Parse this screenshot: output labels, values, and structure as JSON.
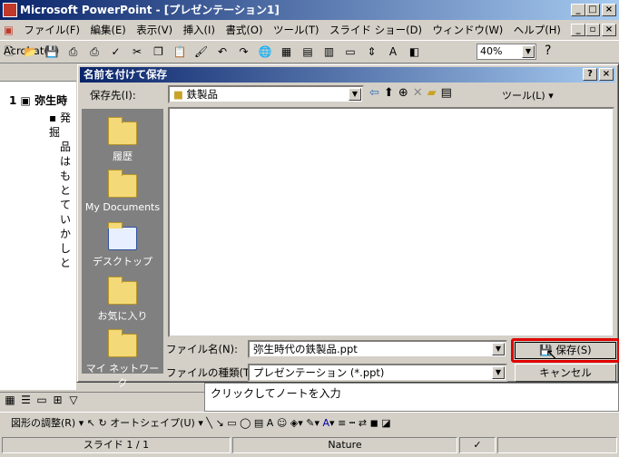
{
  "window": {
    "title": "Microsoft PowerPoint - [プレゼンテーション1]"
  },
  "menu": [
    "ファイル(F)",
    "編集(E)",
    "表示(V)",
    "挿入(I)",
    "書式(O)",
    "ツール(T)",
    "スライド ショー(D)",
    "ウィンドウ(W)",
    "ヘルプ(H)",
    "Acrobat(B)"
  ],
  "toolbar": {
    "zoom": "40%"
  },
  "outline": {
    "slide_number": "1",
    "slide_title": "弥生時",
    "lines": [
      "発掘",
      "品は",
      "もと",
      "てい",
      "かし",
      "と"
    ]
  },
  "dialog": {
    "title": "名前を付けて保存",
    "save_in_label": "保存先(I):",
    "save_in_value": "鉄製品",
    "tools_label": "ツール(L)",
    "places": [
      "履歴",
      "My Documents",
      "デスクトップ",
      "お気に入り",
      "マイ ネットワーク"
    ],
    "filename_label": "ファイル名(N):",
    "filename_value": "弥生時代の鉄製品.ppt",
    "filetype_label": "ファイルの種類(T):",
    "filetype_value": "プレゼンテーション (*.ppt)",
    "save_button": "保存(S)",
    "cancel_button": "キャンセル"
  },
  "notes": {
    "placeholder": "クリックしてノートを入力"
  },
  "drawbar": {
    "adjust": "図形の調整(R)",
    "autoshape": "オートシェイプ(U)"
  },
  "status": {
    "slide": "スライド 1 / 1",
    "design": "Nature"
  }
}
